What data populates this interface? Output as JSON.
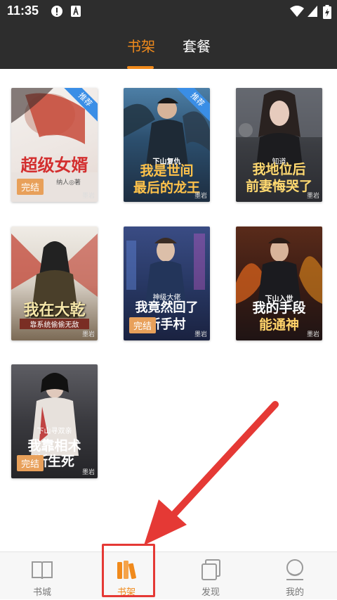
{
  "status_bar": {
    "time": "11:35"
  },
  "header": {
    "tabs": [
      {
        "label": "书架",
        "active": true
      },
      {
        "label": "套餐",
        "active": false
      }
    ]
  },
  "books": [
    {
      "title": "超级女婿",
      "tag": "推荐",
      "badge": "完结",
      "sub": "纳人◎著"
    },
    {
      "title_line1": "我是世间",
      "title_line2": "最后的龙王",
      "tag": "推荐",
      "badge": "",
      "sub": "下山复仇"
    },
    {
      "title_line1": "我地位后",
      "title_line2": "前妻悔哭了",
      "tag": "",
      "badge": "",
      "sub": "知道"
    },
    {
      "title_line1": "我在大乾",
      "title_line2": "靠系统偷偷无敌",
      "tag": "",
      "badge": "",
      "sub": ""
    },
    {
      "title_line1": "我竟然回了",
      "title_line2": "新手村",
      "tag": "",
      "badge": "完结",
      "sub": "神级大佬"
    },
    {
      "title_line1": "我的手段",
      "title_line2": "能通神",
      "tag": "",
      "badge": "",
      "sub": "下山入世"
    },
    {
      "title_line1": "我靠相术",
      "title_line2": "断生死",
      "tag": "",
      "badge": "完结",
      "sub": "下山寻双亲"
    }
  ],
  "watermark": "墨岩",
  "bottom_nav": [
    {
      "label": "书城",
      "icon": "open-book-icon",
      "active": false
    },
    {
      "label": "书架",
      "icon": "bookshelf-icon",
      "active": true
    },
    {
      "label": "发现",
      "icon": "cards-icon",
      "active": false
    },
    {
      "label": "我的",
      "icon": "profile-icon",
      "active": false
    }
  ],
  "colors": {
    "accent": "#f08a1c",
    "header_bg": "#2d2d2d",
    "annotation": "#e53935"
  }
}
